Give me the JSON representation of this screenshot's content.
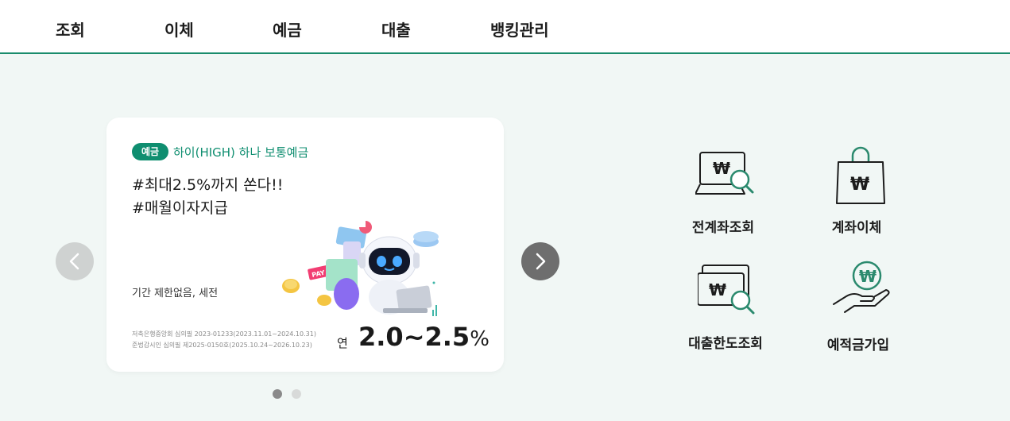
{
  "nav": {
    "items": [
      {
        "label": "조회"
      },
      {
        "label": "이체"
      },
      {
        "label": "예금"
      },
      {
        "label": "대출"
      },
      {
        "label": "뱅킹관리"
      }
    ]
  },
  "banner": {
    "badge": "예금",
    "product_name": "하이(HIGH) 하나 보통예금",
    "headline_1": "#최대2.5%까지 쏜다!!",
    "headline_2": "#매월이자지급",
    "period": "기간 제한없음, 세전",
    "legal_1": "저축은행중앙회 심의필 2023-01233(2023.11.01~2024.10.31)",
    "legal_2": "준법감시인 심의필 제2025-0150호(2025.10.24~2026.10.23)",
    "rate_prefix": "연",
    "rate_value": "2.0~2.5",
    "rate_unit": "%",
    "illustration_tag": "PAY",
    "active_slide": 1,
    "slide_count": 2
  },
  "quick_menu": {
    "items": [
      {
        "label": "전계좌조회",
        "icon": "laptop-search-won-icon"
      },
      {
        "label": "계좌이체",
        "icon": "shopping-bag-won-icon"
      },
      {
        "label": "대출한도조회",
        "icon": "cards-search-won-icon"
      },
      {
        "label": "예적금가입",
        "icon": "hand-coin-won-icon"
      }
    ]
  },
  "colors": {
    "accent": "#0f8e70",
    "nav_border": "#1a8c6c",
    "background": "#f1f7f5"
  }
}
